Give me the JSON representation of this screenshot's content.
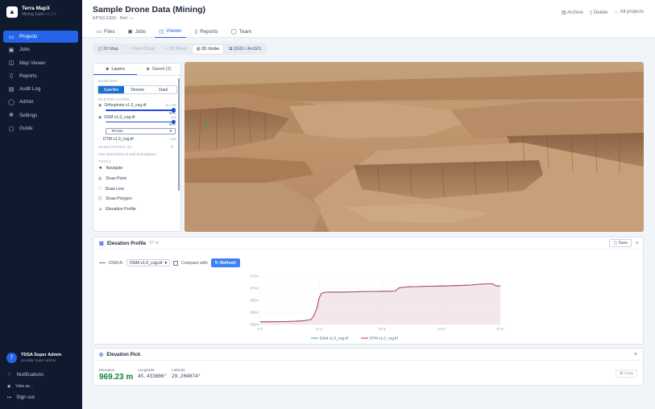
{
  "sidebar": {
    "brand": {
      "name": "Terra MapX",
      "subtitle": "Mining Suite",
      "version": "v2.1.0"
    },
    "items": [
      {
        "label": "Projects",
        "icon": "folder-icon",
        "active": true
      },
      {
        "label": "Jobs",
        "icon": "briefcase-icon"
      },
      {
        "label": "Map Viewer",
        "icon": "map-icon"
      },
      {
        "label": "Reports",
        "icon": "file-icon"
      },
      {
        "label": "Audit Log",
        "icon": "clipboard-icon"
      },
      {
        "label": "Admin",
        "icon": "user-icon"
      },
      {
        "label": "Settings",
        "icon": "gear-icon"
      },
      {
        "label": "Guide",
        "icon": "book-icon"
      }
    ],
    "user": {
      "initial": "T",
      "name": "TDSA Super Admin",
      "role": "provider super admin"
    },
    "notifications": "Notifications",
    "view_as": "View as...",
    "sign_out": "Sign out"
  },
  "header": {
    "title": "Sample Drone Data (Mining)",
    "subtitle": "EPSG:6326 · Ref: —",
    "actions": {
      "archive": "Archive",
      "delete": "Delete",
      "all_projects": "All projects"
    }
  },
  "tabs": [
    "Files",
    "Jobs",
    "Viewer",
    "Reports",
    "Team"
  ],
  "view_tabs": [
    "2D Map",
    "Point Cloud",
    "3D Mixed",
    "3D Globe",
    "QGIS / ArcGIS"
  ],
  "layers_panel": {
    "tabs": {
      "layers": "Layers",
      "saved": "Saved (2)"
    },
    "base_map_label": "Base Map",
    "base_maps": [
      "Satellite",
      "Streets",
      "Dark"
    ],
    "raster_label": "Raster Layers",
    "rasters": [
      {
        "name": "Orthophoto v1.0_cog.tif",
        "size": "36.9 MB",
        "opacity": "90%",
        "value": 0.9
      },
      {
        "name": "DSM v1.0_cog.tif",
        "size": "1MB",
        "opacity": "90%",
        "value": 0.9,
        "render": "Terrain"
      },
      {
        "name": "DTM v1.0_cog.tif",
        "size": "2MB"
      }
    ],
    "annotations_label": "Annotations (0)",
    "annotations_hint": "Use tools below to add annotations.",
    "tools_label": "Tools",
    "tools": [
      {
        "label": "Navigate",
        "icon": "hand-icon"
      },
      {
        "label": "Draw Point",
        "icon": "pin-icon"
      },
      {
        "label": "Draw Line",
        "icon": "line-icon"
      },
      {
        "label": "Draw Polygon",
        "icon": "polygon-icon"
      },
      {
        "label": "Elevation Profile",
        "icon": "profile-icon"
      }
    ]
  },
  "elevation_profile": {
    "title": "Elevation Profile",
    "length": "57 m",
    "save": "Save",
    "dsm_label": "DSM A:",
    "dsm_select": "DSM v1.0_cog.tif",
    "compare": "Compare with",
    "refresh": "Refresh"
  },
  "chart_data": {
    "type": "line",
    "x": [
      0,
      2,
      4,
      6,
      8,
      10,
      12,
      12.7,
      13.5,
      14,
      14.5,
      15,
      16,
      20,
      24,
      32,
      33,
      35,
      40,
      45,
      50,
      52,
      54,
      55,
      55.5,
      56,
      57
    ],
    "xticks": [
      "0 m",
      "14 m",
      "29 m",
      "43 m",
      "57 m"
    ],
    "xtick_values": [
      0,
      14,
      29,
      43,
      57
    ],
    "yticks": [
      "855m",
      "860m",
      "865m",
      "870m",
      "875m"
    ],
    "ytick_values": [
      855,
      860,
      865,
      870,
      875
    ],
    "ylim": [
      855,
      875
    ],
    "xlim": [
      0,
      57
    ],
    "grid": true,
    "legend_position": "bottom",
    "series": [
      {
        "name": "DSM v1.0_cog.tif",
        "color": "#1d9bd8",
        "values": [
          856.1,
          856.1,
          856.1,
          856.2,
          856.3,
          856.5,
          857.0,
          858.5,
          862.0,
          866.0,
          867.8,
          868.2,
          868.4,
          868.4,
          868.6,
          868.8,
          870.2,
          870.6,
          870.8,
          871.0,
          871.3,
          871.7,
          871.8,
          871.9,
          871.5,
          871.0,
          870.9
        ]
      },
      {
        "name": "DTM v1.0_cog.tif",
        "color": "#be3555",
        "values": [
          856.1,
          856.1,
          856.1,
          856.2,
          856.3,
          856.5,
          857.0,
          858.5,
          862.0,
          866.0,
          867.8,
          868.2,
          868.4,
          868.4,
          868.6,
          868.8,
          870.2,
          870.6,
          870.8,
          871.0,
          871.3,
          871.7,
          871.8,
          871.9,
          871.5,
          871.0,
          870.9
        ]
      }
    ]
  },
  "elevation_pick": {
    "title": "Elevation Pick",
    "elevation_label": "Elevation",
    "elevation": "969.23 m",
    "longitude_label": "Longitude",
    "longitude": "45.433806°",
    "latitude_label": "Latitude",
    "latitude": "29.204074°",
    "copy": "Copy"
  }
}
